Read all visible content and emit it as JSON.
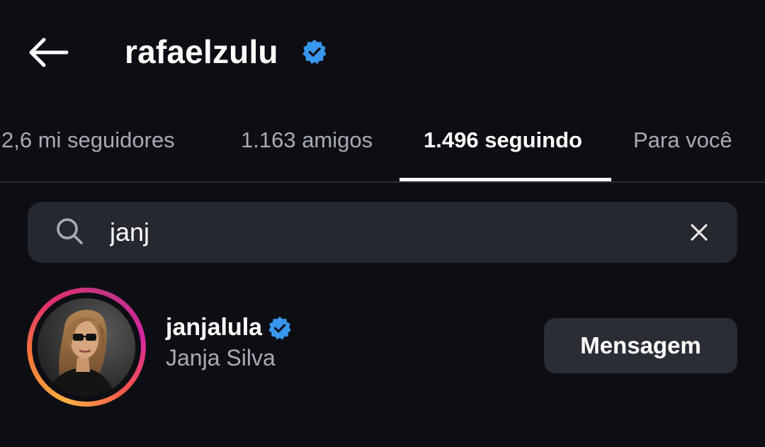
{
  "header": {
    "title": "rafaelzulu",
    "back_icon": "arrow-left-icon",
    "verified_icon": "verified-badge-icon"
  },
  "tabs": [
    {
      "label": "2,6 mi seguidores",
      "active": false
    },
    {
      "label": "1.163 amigos",
      "active": false
    },
    {
      "label": "1.496 seguindo",
      "active": true
    },
    {
      "label": "Para você",
      "active": false
    }
  ],
  "search": {
    "value": "janj",
    "search_icon": "search-icon",
    "clear_icon": "close-icon"
  },
  "results": [
    {
      "handle": "janjalula",
      "full_name": "Janja Silva",
      "verified": true,
      "has_story_ring": true,
      "action_label": "Mensagem"
    }
  ],
  "colors": {
    "background": "#0c0e13",
    "surface": "#25282e",
    "button": "#2a2d33",
    "verified_blue": "#3897f0",
    "muted_text": "#a8abb2"
  }
}
